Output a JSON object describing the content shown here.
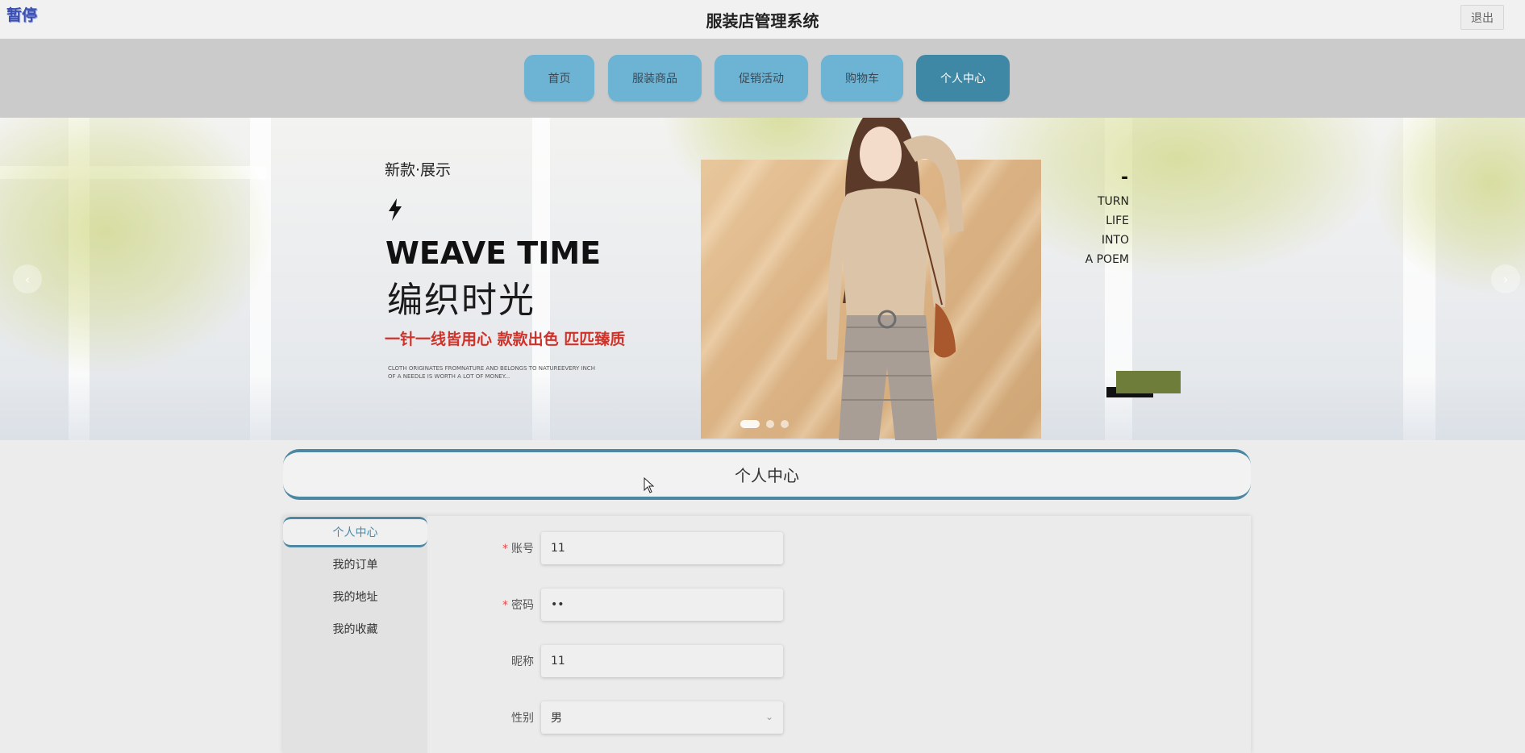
{
  "header": {
    "pause_badge": "暂停",
    "title": "服装店管理系统",
    "logout_label": "退出"
  },
  "nav": {
    "items": [
      {
        "label": "首页",
        "active": false
      },
      {
        "label": "服装商品",
        "active": false
      },
      {
        "label": "促销活动",
        "active": false
      },
      {
        "label": "购物车",
        "active": false
      },
      {
        "label": "个人中心",
        "active": true
      }
    ]
  },
  "banner": {
    "heading_small": "新款·展示",
    "title_en": "WEAVE TIME",
    "title_cn": "编织时光",
    "slogan": "一针一线皆用心 款款出色 匹匹臻质",
    "fine_print": "CLOTH ORIGINATES FROMNATURE AND BELONGS TO NATUREEVERY INCH OF A NEEDLE IS WORTH A LOT OF MONEY...",
    "poem_dash": "-",
    "poem_lines": [
      "TURN",
      "LIFE",
      "INTO",
      "A POEM"
    ],
    "carousel_dots": 3,
    "active_dot": 0,
    "prev_icon": "chevron-left-icon",
    "next_icon": "chevron-right-icon"
  },
  "section": {
    "title": "个人中心"
  },
  "side_menu": {
    "items": [
      {
        "label": "个人中心",
        "active": true
      },
      {
        "label": "我的订单",
        "active": false
      },
      {
        "label": "我的地址",
        "active": false
      },
      {
        "label": "我的收藏",
        "active": false
      }
    ]
  },
  "form": {
    "account_label": "账号",
    "account_value": "11",
    "password_label": "密码",
    "password_value": "••",
    "nickname_label": "昵称",
    "nickname_value": "11",
    "gender_label": "性别",
    "gender_value": "男"
  },
  "colors": {
    "nav_button": "#6cb3d4",
    "nav_active": "#3f88a5",
    "accent": "#4d87a2",
    "required": "#e04b4b",
    "slogan_red": "#d0322a"
  }
}
